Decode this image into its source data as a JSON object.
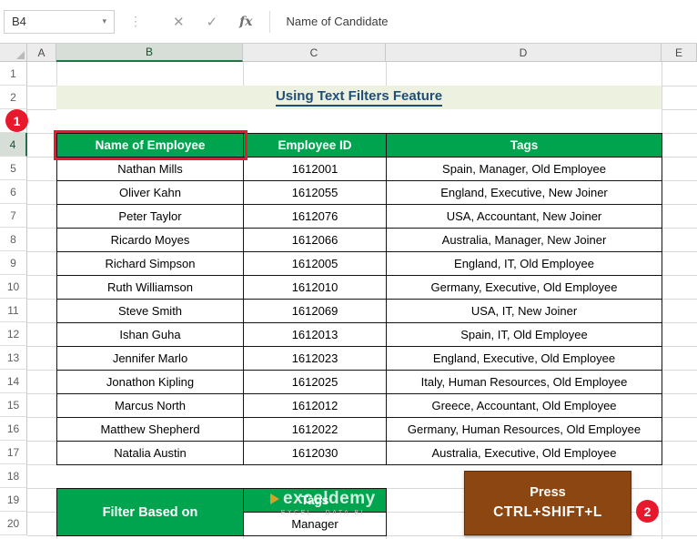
{
  "formula_bar": {
    "cell_reference": "B4",
    "formula": "Name of Candidate",
    "cancel_icon": "✕",
    "enter_icon": "✓",
    "fx_icon": "fx",
    "dropdown_icon": "▾",
    "drag_dots": "⋮"
  },
  "sheet": {
    "columns": [
      "A",
      "B",
      "C",
      "D",
      "E"
    ],
    "row_numbers": [
      "1",
      "2",
      "3",
      "4",
      "5",
      "6",
      "7",
      "8",
      "9",
      "10",
      "11",
      "12",
      "13",
      "14",
      "15",
      "16",
      "17",
      "18",
      "19",
      "20"
    ]
  },
  "title": "Using Text Filters Feature",
  "table": {
    "headers": {
      "name": "Name of Employee",
      "id": "Employee ID",
      "tags": "Tags"
    },
    "rows": [
      {
        "name": "Nathan Mills",
        "id": "1612001",
        "tags": "Spain, Manager, Old Employee"
      },
      {
        "name": "Oliver Kahn",
        "id": "1612055",
        "tags": "England, Executive, New Joiner"
      },
      {
        "name": "Peter Taylor",
        "id": "1612076",
        "tags": "USA, Accountant, New Joiner"
      },
      {
        "name": "Ricardo Moyes",
        "id": "1612066",
        "tags": "Australia, Manager, New Joiner"
      },
      {
        "name": "Richard Simpson",
        "id": "1612005",
        "tags": "England, IT, Old Employee"
      },
      {
        "name": "Ruth Williamson",
        "id": "1612010",
        "tags": "Germany, Executive, Old Employee"
      },
      {
        "name": "Steve Smith",
        "id": "1612069",
        "tags": "USA, IT, New Joiner"
      },
      {
        "name": "Ishan Guha",
        "id": "1612013",
        "tags": "Spain, IT, Old Employee"
      },
      {
        "name": "Jennifer Marlo",
        "id": "1612023",
        "tags": "England, Executive, Old Employee"
      },
      {
        "name": "Jonathon Kipling",
        "id": "1612025",
        "tags": "Italy, Human Resources, Old Employee"
      },
      {
        "name": "Marcus North",
        "id": "1612012",
        "tags": "Greece, Accountant, Old Employee"
      },
      {
        "name": "Matthew Shepherd",
        "id": "1612022",
        "tags": "Germany, Human Resources, Old Employee"
      },
      {
        "name": "Natalia Austin",
        "id": "1612030",
        "tags": "Australia, Executive, Old Employee"
      }
    ]
  },
  "filter_section": {
    "label": "Filter Based on",
    "column_header": "Tags",
    "value": "Manager"
  },
  "shortcut_callout": {
    "line1": "Press",
    "line2": "CTRL+SHIFT+L"
  },
  "annotations": {
    "step1": "1",
    "step2": "2"
  },
  "watermark": {
    "brand": "exceldemy",
    "tagline": "EXCEL · DATA BI"
  },
  "colors": {
    "header-green": "#00A44F",
    "title-blue": "#1F4E79",
    "title-band": "#EDF2E0",
    "callout-brown": "#8C4612",
    "annotation-red": "#E8192C",
    "selection-green": "#217346",
    "cell-border": "#141414",
    "gridline": "#D8D8D8"
  }
}
